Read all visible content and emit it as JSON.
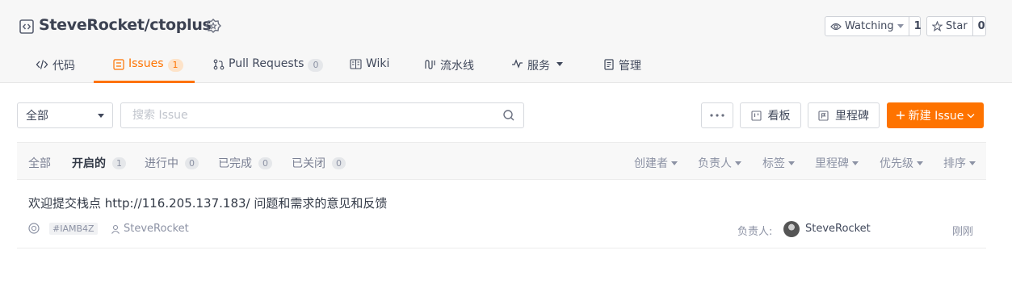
{
  "repo": {
    "title": "SteveRocket/ctoplus"
  },
  "actions": {
    "watch": {
      "label": "Watching",
      "count": "1"
    },
    "star": {
      "label": "Star",
      "count": "0"
    }
  },
  "tabs": [
    {
      "label": "代码",
      "icon": "code-icon"
    },
    {
      "label": "Issues",
      "count": "1",
      "icon": "issues-icon"
    },
    {
      "label": "Pull Requests",
      "count": "0",
      "icon": "pull-request-icon"
    },
    {
      "label": "Wiki",
      "icon": "wiki-icon"
    },
    {
      "label": "流水线",
      "icon": "pipeline-icon"
    },
    {
      "label": "服务",
      "icon": "service-icon"
    },
    {
      "label": "管理",
      "icon": "manage-icon"
    }
  ],
  "toolbar": {
    "scope": "全部",
    "search_placeholder": "搜索 Issue",
    "board_label": "看板",
    "milestone_label": "里程碑",
    "new_label": "新建 Issue"
  },
  "states": [
    {
      "label": "全部"
    },
    {
      "label": "开启的",
      "count": "1"
    },
    {
      "label": "进行中",
      "count": "0"
    },
    {
      "label": "已完成",
      "count": "0"
    },
    {
      "label": "已关闭",
      "count": "0"
    }
  ],
  "filters": [
    "创建者",
    "负责人",
    "标签",
    "里程碑",
    "优先级",
    "排序"
  ],
  "issue": {
    "title": "欢迎提交栈点 http://116.205.137.183/ 问题和需求的意见和反馈",
    "id": "#IAMB4Z",
    "author": "SteveRocket",
    "assignee_label": "负责人:",
    "assignee": "SteveRocket",
    "time": "刚刚"
  },
  "colors": {
    "accent": "#fe7300",
    "text": "#40485b",
    "muted": "#8c92a4"
  }
}
